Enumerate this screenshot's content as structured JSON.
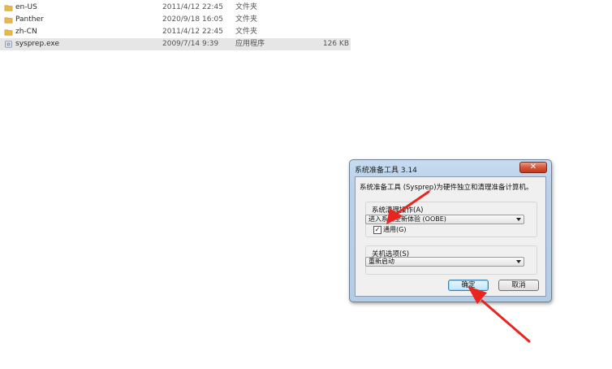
{
  "files": [
    {
      "name": "en-US",
      "date": "2011/4/12 22:45",
      "type": "文件夹",
      "size": "",
      "icon": "folder-icon"
    },
    {
      "name": "Panther",
      "date": "2020/9/18 16:05",
      "type": "文件夹",
      "size": "",
      "icon": "folder-icon"
    },
    {
      "name": "zh-CN",
      "date": "2011/4/12 22:45",
      "type": "文件夹",
      "size": "",
      "icon": "folder-icon"
    },
    {
      "name": "sysprep.exe",
      "date": "2009/7/14 9:39",
      "type": "应用程序",
      "size": "126 KB",
      "icon": "exe-icon"
    }
  ],
  "dialog": {
    "title": "系统准备工具 3.14",
    "close_label": "✕",
    "description": "系统准备工具 (Sysprep)为硬件独立和清理准备计算机。",
    "cleanup": {
      "label": "系统清理操作(A)",
      "selected": "进入系统全新体验 (OOBE)",
      "generalize_label": "通用(G)",
      "generalize_checked": true
    },
    "shutdown": {
      "label": "关机选项(S)",
      "selected": "重新启动"
    },
    "ok_label": "确定",
    "cancel_label": "取消"
  },
  "colors": {
    "arrow": "#e8261f",
    "folder": "#e9b84a",
    "close_button": "#c94a30"
  }
}
